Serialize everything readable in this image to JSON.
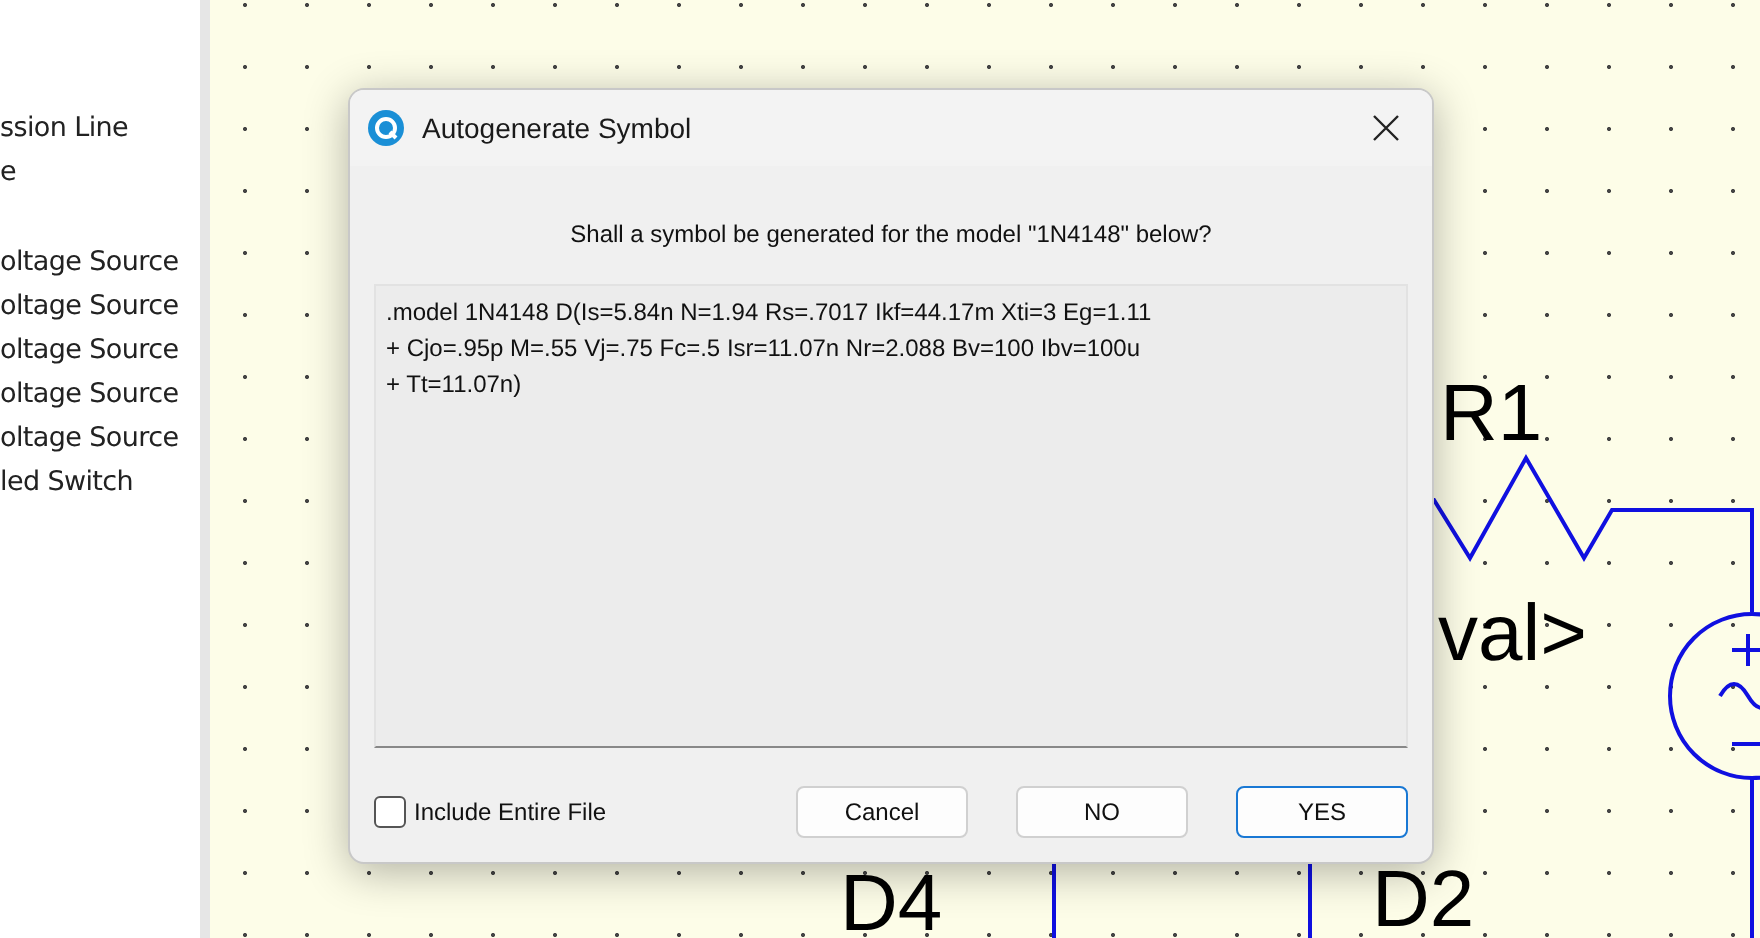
{
  "sidebar": {
    "groups": [
      [
        "ssion Line",
        "e"
      ],
      [
        "oltage Source",
        "oltage Source",
        "oltage Source",
        "oltage Source",
        "oltage Source",
        "led Switch"
      ]
    ]
  },
  "schematic": {
    "resistor_label": "R1",
    "value_label": "val>",
    "diode2_label": "D2",
    "diode4_label": "D4"
  },
  "dialog": {
    "title": "Autogenerate Symbol",
    "message": "Shall a symbol be generated for the model \"1N4148\" below?",
    "model_lines": [
      ".model 1N4148 D(Is=5.84n N=1.94 Rs=.7017 Ikf=44.17m Xti=3 Eg=1.11",
      "+ Cjo=.95p M=.55 Vj=.75 Fc=.5 Isr=11.07n Nr=2.088 Bv=100 Ibv=100u",
      "+ Tt=11.07n)"
    ],
    "checkbox": {
      "label": "Include Entire File",
      "checked": false
    },
    "buttons": [
      {
        "label": "Cancel",
        "default": false
      },
      {
        "label": "NO",
        "default": false
      },
      {
        "label": "YES",
        "default": true
      }
    ]
  }
}
